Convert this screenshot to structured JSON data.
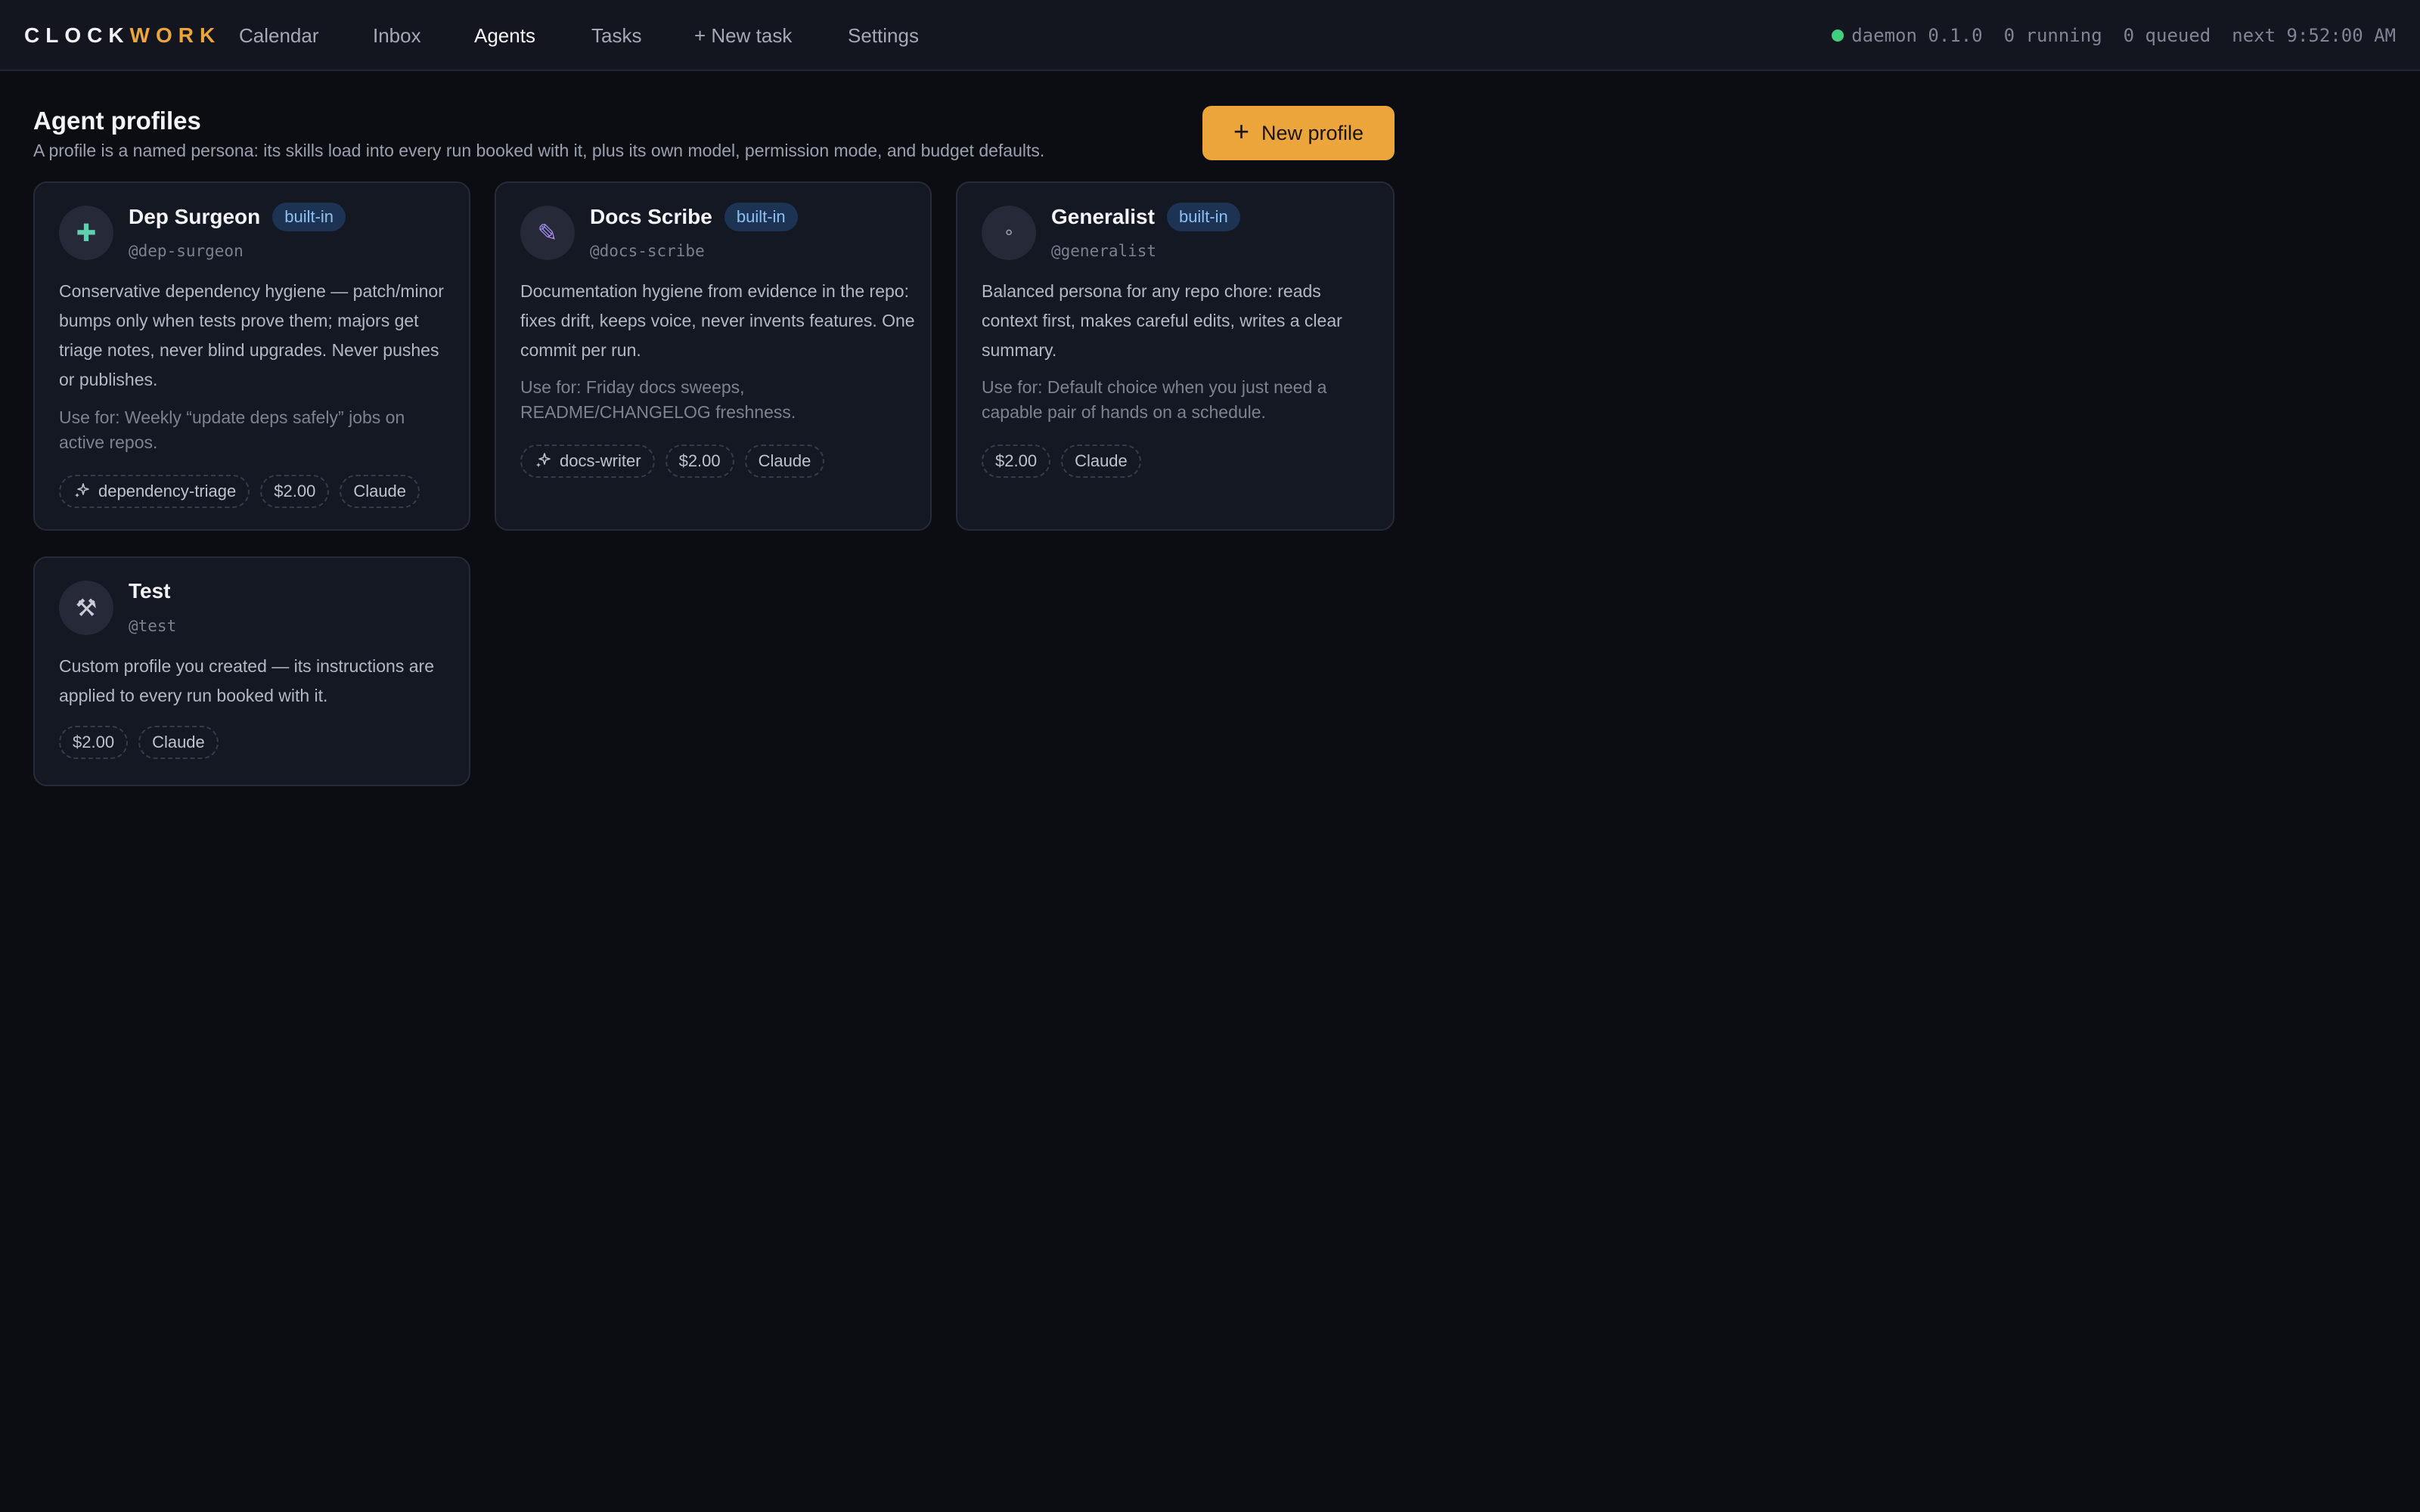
{
  "brand": {
    "part1": "CLOCK",
    "part2": "WORK"
  },
  "nav": {
    "calendar": "Calendar",
    "inbox": "Inbox",
    "agents": "Agents",
    "tasks": "Tasks",
    "new_task": "+ New task",
    "settings": "Settings"
  },
  "status": {
    "daemon": "daemon 0.1.0",
    "running": "0 running",
    "queued": "0 queued",
    "next": "next 9:52:00 AM",
    "dot_color": "#3fcf7e"
  },
  "header": {
    "title": "Agent profiles",
    "subtitle": "A profile is a named persona: its skills load into every run booked with it, plus its own model, permission mode, and budget defaults.",
    "new_button": "New profile",
    "new_button_icon": "plus-icon"
  },
  "profiles": [
    {
      "name": "Dep Surgeon",
      "badge": "built-in",
      "handle": "@dep-surgeon",
      "icon": "medical-cross-icon",
      "icon_glyph": "✚",
      "icon_color": "#5fd1b0",
      "description": "Conservative dependency hygiene — patch/minor bumps only when tests prove them; majors get triage notes, never blind upgrades. Never pushes or publishes.",
      "use_for": "Use for: Weekly “update deps safely” jobs on active repos.",
      "skill": "dependency-triage",
      "budget": "$2.00",
      "model": "Claude"
    },
    {
      "name": "Docs Scribe",
      "badge": "built-in",
      "handle": "@docs-scribe",
      "icon": "pencil-icon",
      "icon_glyph": "✎",
      "icon_color": "#a58cf0",
      "description": "Documentation hygiene from evidence in the repo: fixes drift, keeps voice, never invents features. One commit per run.",
      "use_for": "Use for: Friday docs sweeps, README/CHANGELOG freshness.",
      "skill": "docs-writer",
      "budget": "$2.00",
      "model": "Claude"
    },
    {
      "name": "Generalist",
      "badge": "built-in",
      "handle": "@generalist",
      "icon": "dot-icon",
      "icon_glyph": "∘",
      "icon_color": "#9aa0ad",
      "description": "Balanced persona for any repo chore: reads context first, makes careful edits, writes a clear summary.",
      "use_for": "Use for: Default choice when you just need a capable pair of hands on a schedule.",
      "budget": "$2.00",
      "model": "Claude"
    },
    {
      "name": "Test",
      "handle": "@test",
      "icon": "hammer-wrench-icon",
      "icon_glyph": "⚒",
      "icon_color": "#c9ccd4",
      "description": "Custom profile you created — its instructions are applied to every run booked with it.",
      "budget": "$2.00",
      "model": "Claude"
    }
  ],
  "skill_icon": "sparkle-icon",
  "accent_color": "#eca53a",
  "badge_color": "#8cc0f2"
}
